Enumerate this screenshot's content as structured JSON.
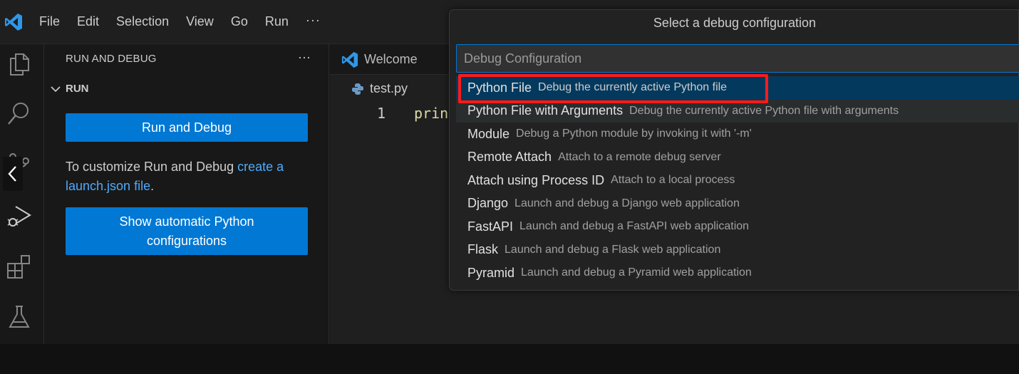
{
  "menubar": {
    "items": [
      "File",
      "Edit",
      "Selection",
      "View",
      "Go",
      "Run"
    ],
    "more": "···"
  },
  "activitybar": {
    "icons": [
      "explorer-icon",
      "search-icon",
      "source-control-icon",
      "run-debug-icon",
      "extensions-icon",
      "testing-icon"
    ]
  },
  "sidebar": {
    "title": "RUN AND DEBUG",
    "more": "···",
    "section": "RUN",
    "run_button": "Run and Debug",
    "text_before_link": "To customize Run and Debug ",
    "link_text": "create a launch.json file",
    "text_after_link": ".",
    "show_button": "Show automatic Python configurations"
  },
  "editor": {
    "tab_label": "Welcome",
    "breadcrumb": "test.py",
    "line_number": "1",
    "code": "prin"
  },
  "quickpick": {
    "title": "Select a debug configuration",
    "placeholder": "Debug Configuration",
    "items": [
      {
        "label": "Python File",
        "description": "Debug the currently active Python file"
      },
      {
        "label": "Python File with Arguments",
        "description": "Debug the currently active Python file with arguments"
      },
      {
        "label": "Module",
        "description": "Debug a Python module by invoking it with '-m'"
      },
      {
        "label": "Remote Attach",
        "description": "Attach to a remote debug server"
      },
      {
        "label": "Attach using Process ID",
        "description": "Attach to a local process"
      },
      {
        "label": "Django",
        "description": "Launch and debug a Django web application"
      },
      {
        "label": "FastAPI",
        "description": "Launch and debug a FastAPI web application"
      },
      {
        "label": "Flask",
        "description": "Launch and debug a Flask web application"
      },
      {
        "label": "Pyramid",
        "description": "Launch and debug a Pyramid web application"
      }
    ]
  },
  "colors": {
    "accent": "#0078d4",
    "selection": "#04395e",
    "highlight": "#ff1a1a",
    "link": "#4daafc"
  }
}
